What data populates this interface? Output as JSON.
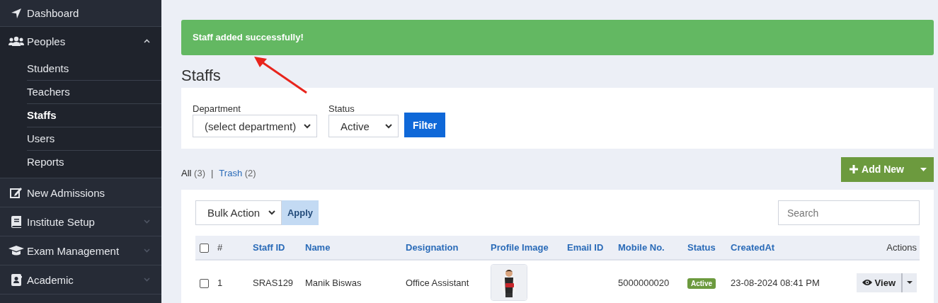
{
  "sidebar": {
    "items": [
      {
        "label": "Dashboard"
      },
      {
        "label": "Peoples",
        "expanded": true,
        "children": [
          {
            "label": "Students",
            "selected": false
          },
          {
            "label": "Teachers",
            "selected": false
          },
          {
            "label": "Staffs",
            "selected": true
          },
          {
            "label": "Users",
            "selected": false
          },
          {
            "label": "Reports",
            "selected": false
          }
        ]
      },
      {
        "label": "New Admissions"
      },
      {
        "label": "Institute Setup",
        "expanded": false
      },
      {
        "label": "Exam Management",
        "expanded": false
      },
      {
        "label": "Academic",
        "expanded": false
      }
    ]
  },
  "alert": {
    "message": "Staff added successfully!"
  },
  "page_title": "Staffs",
  "filters": [
    {
      "label": "Department",
      "value": "(select department)"
    },
    {
      "label": "Status",
      "value": "Active"
    }
  ],
  "filter_button": "Filter",
  "views": [
    {
      "label": "All",
      "count": "(3)",
      "selected": true
    },
    {
      "label": "Trash",
      "count": "(2)",
      "selected": false
    }
  ],
  "views_separator": "|",
  "add_button": "Add New",
  "bulk_action": {
    "value": "Bulk Action",
    "button": "Apply"
  },
  "search": {
    "placeholder": "Search"
  },
  "table": {
    "header_checked": false,
    "columns": [
      "#",
      "Staff ID",
      "Name",
      "Designation",
      "Profile Image",
      "Email ID",
      "Mobile No.",
      "Status",
      "CreatedAt",
      "Actions"
    ],
    "rows": [
      {
        "checked": false,
        "number": "1",
        "staff_id": "SRAS129",
        "name": "Manik Biswas",
        "designation": "Office Assistant",
        "mobile": "5000000020",
        "status": "Active",
        "created_at": "23-08-2024 08:41 PM",
        "action": "View"
      }
    ]
  }
}
